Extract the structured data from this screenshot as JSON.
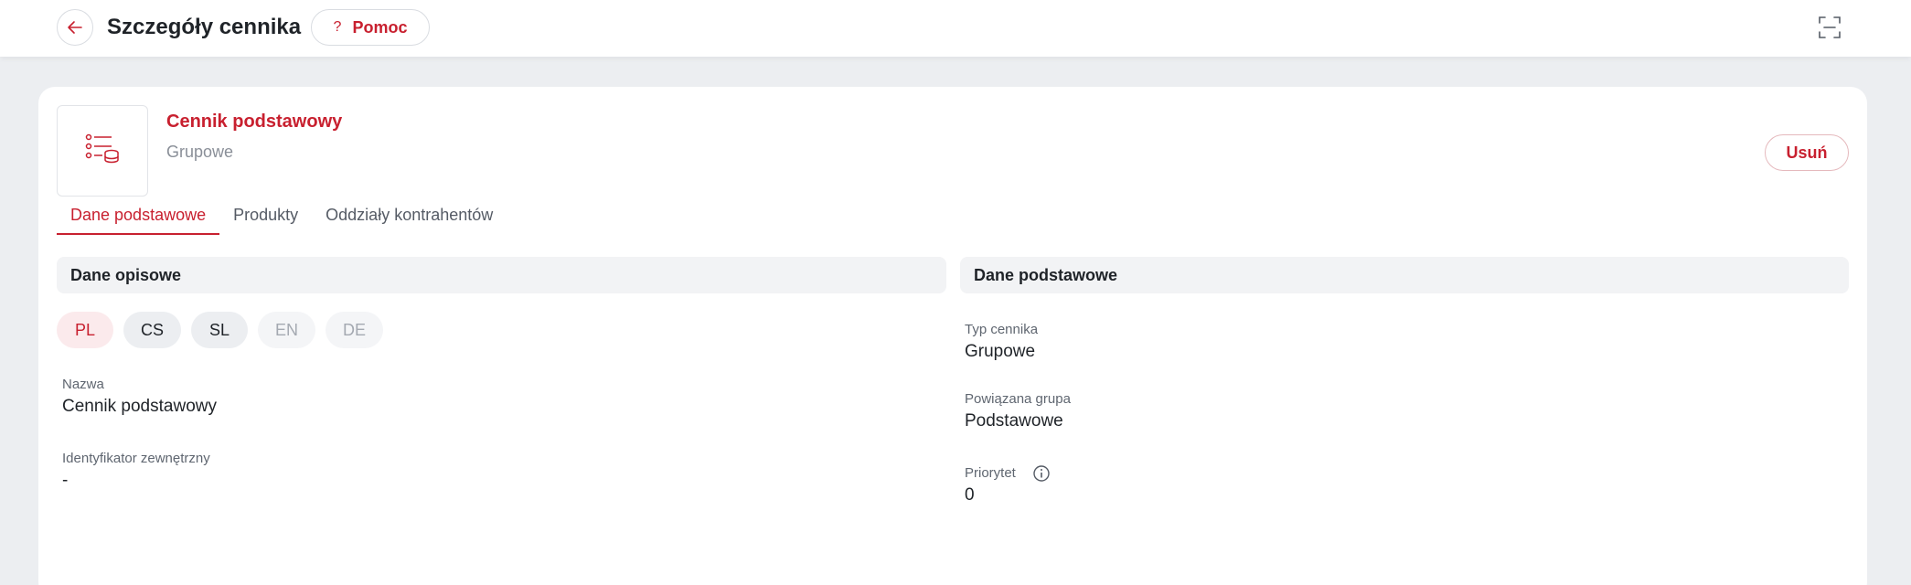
{
  "header": {
    "title": "Szczegóły cennika",
    "help_label": "Pomoc",
    "help_icon": "?"
  },
  "pricelist": {
    "name": "Cennik podstawowy",
    "type": "Grupowe",
    "delete_label": "Usuń"
  },
  "tabs": [
    {
      "label": "Dane podstawowe"
    },
    {
      "label": "Produkty"
    },
    {
      "label": "Oddziały kontrahentów"
    }
  ],
  "left_section": {
    "title": "Dane opisowe",
    "languages": [
      "PL",
      "CS",
      "SL",
      "EN",
      "DE"
    ],
    "name_label": "Nazwa",
    "name_value": "Cennik podstawowy",
    "ext_id_label": "Identyfikator zewnętrzny",
    "ext_id_value": "-"
  },
  "right_section": {
    "title": "Dane podstawowe",
    "type_label": "Typ cennika",
    "type_value": "Grupowe",
    "group_label": "Powiązana grupa",
    "group_value": "Podstawowe",
    "priority_label": "Priorytet",
    "priority_value": "0"
  },
  "colors": {
    "accent": "#c8202f",
    "background": "#eceef1",
    "card": "#ffffff"
  }
}
